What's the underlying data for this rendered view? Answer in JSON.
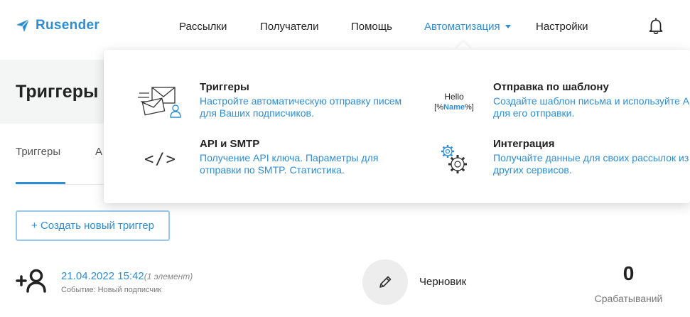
{
  "app": {
    "logo_text": "Rusender",
    "accent_color": "#2d8ed6"
  },
  "nav": {
    "items": [
      {
        "label": "Рассылки",
        "active": false
      },
      {
        "label": "Получатели",
        "active": false
      },
      {
        "label": "Помощь",
        "active": false
      },
      {
        "label": "Автоматизация",
        "active": true
      },
      {
        "label": "Настройки",
        "active": false
      }
    ],
    "notifications_icon": "bell-icon"
  },
  "page": {
    "title": "Триггеры",
    "tabs": [
      {
        "label": "Триггеры",
        "active": true
      },
      {
        "label": "А",
        "active": false
      }
    ],
    "create_button_label": "+ Создать новый триггер"
  },
  "trigger": {
    "icon": "add-user-icon",
    "date": "21.04.2022 15:42",
    "elements": "(1 элемент)",
    "event": "Событие: Новый подписчик",
    "edit_icon": "pencil-icon",
    "status": "Черновик",
    "fires_count": "0",
    "fires_label": "Срабатываний"
  },
  "dropdown": {
    "items": [
      {
        "title": "Триггеры",
        "description": "Настройте автоматическую отправку писем для Ваших подписчиков.",
        "icon": "envelope-user-icon"
      },
      {
        "title": "Отправка по шаблону",
        "description": "Создайте шаблон письма и используйте API для его отправки.",
        "icon": "hello-template-icon"
      },
      {
        "title": "API и SMTP",
        "description": "Получение API ключа. Параметры для отправки по SMTP. Статистика.",
        "icon": "code-icon"
      },
      {
        "title": "Интеграция",
        "description": "Получайте данные для своих рассылок из других сервисов.",
        "icon": "gears-icon"
      }
    ],
    "template_icon_text": {
      "hello": "Hello",
      "open": "[%",
      "name": "Name",
      "close": "%]"
    },
    "code_icon_text": "</>"
  }
}
